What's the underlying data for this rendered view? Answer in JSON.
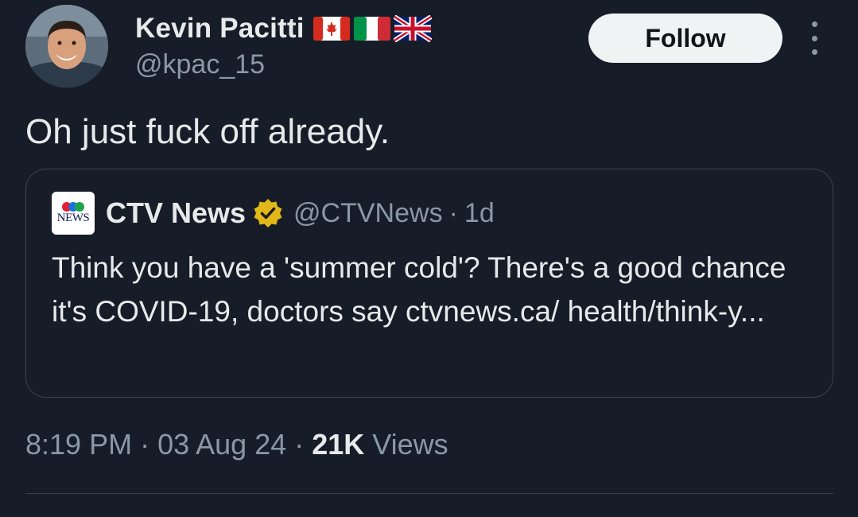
{
  "author": {
    "display_name": "Kevin Pacitti",
    "handle": "@kpac_15",
    "flags": [
      "canada-flag-icon",
      "italy-flag-icon",
      "uk-flag-icon"
    ]
  },
  "actions": {
    "follow_label": "Follow",
    "more_icon": "more-vertical-icon"
  },
  "tweet": {
    "text": "Oh just fuck off already."
  },
  "quoted": {
    "logo_text": "NEWS",
    "name": "CTV News",
    "verified_icon": "gold-verified-badge-icon",
    "handle": "@CTVNews",
    "separator": "·",
    "time": "1d",
    "text": "Think you have a 'summer cold'? There's a good chance it's COVID-19, doctors say ctvnews.ca/ health/think-y..."
  },
  "meta": {
    "time": "8:19 PM",
    "separator": "·",
    "date": "03 Aug 24",
    "views_count": "21K",
    "views_label": "Views"
  },
  "colors": {
    "background": "#161d28",
    "text_primary": "#e7e9ea",
    "text_secondary": "#8b98a5",
    "border": "#38444d",
    "follow_bg": "#eff3f4",
    "verified_gold": "#e2b719"
  }
}
